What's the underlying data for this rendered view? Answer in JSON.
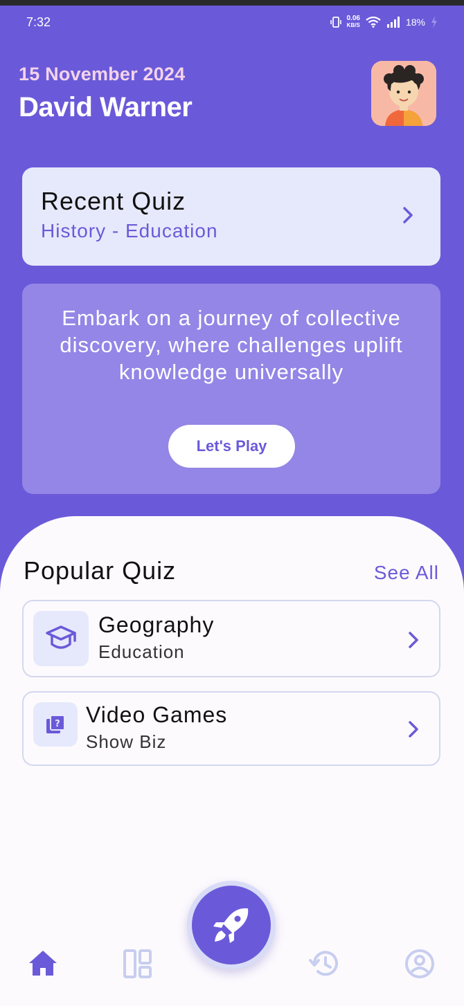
{
  "status_bar": {
    "time": "7:32",
    "speed_value": "0.06",
    "speed_unit": "KB/S",
    "battery": "18%"
  },
  "header": {
    "date": "15 November 2024",
    "user_name": "David Warner",
    "avatar_icon": "user-avatar"
  },
  "recent_quiz": {
    "title": "Recent Quiz",
    "subtitle": "History - Education",
    "icon": "chevron-right-icon"
  },
  "promo": {
    "text": "Embark on a journey of collective discovery, where challenges uplift knowledge universally",
    "button_label": "Let's Play"
  },
  "popular": {
    "title": "Popular Quiz",
    "see_all_label": "See All",
    "items": [
      {
        "name": "Geography",
        "category": "Education",
        "icon": "graduation-cap-icon"
      },
      {
        "name": "Video Games",
        "category": "Show Biz",
        "icon": "quiz-question-icon"
      }
    ]
  },
  "bottom_nav": {
    "items": [
      {
        "name": "home",
        "icon": "home-icon",
        "active": true
      },
      {
        "name": "dashboard",
        "icon": "dashboard-icon",
        "active": false
      },
      {
        "name": "start",
        "icon": "rocket-icon",
        "active": false
      },
      {
        "name": "history",
        "icon": "history-icon",
        "active": false
      },
      {
        "name": "profile",
        "icon": "profile-icon",
        "active": false
      }
    ]
  },
  "colors": {
    "primary": "#6a5ad9",
    "card_light": "#e6e9fb",
    "promo_card": "#9386e6",
    "date_text": "#f3d3ea",
    "inactive_nav": "#c7ceef"
  }
}
